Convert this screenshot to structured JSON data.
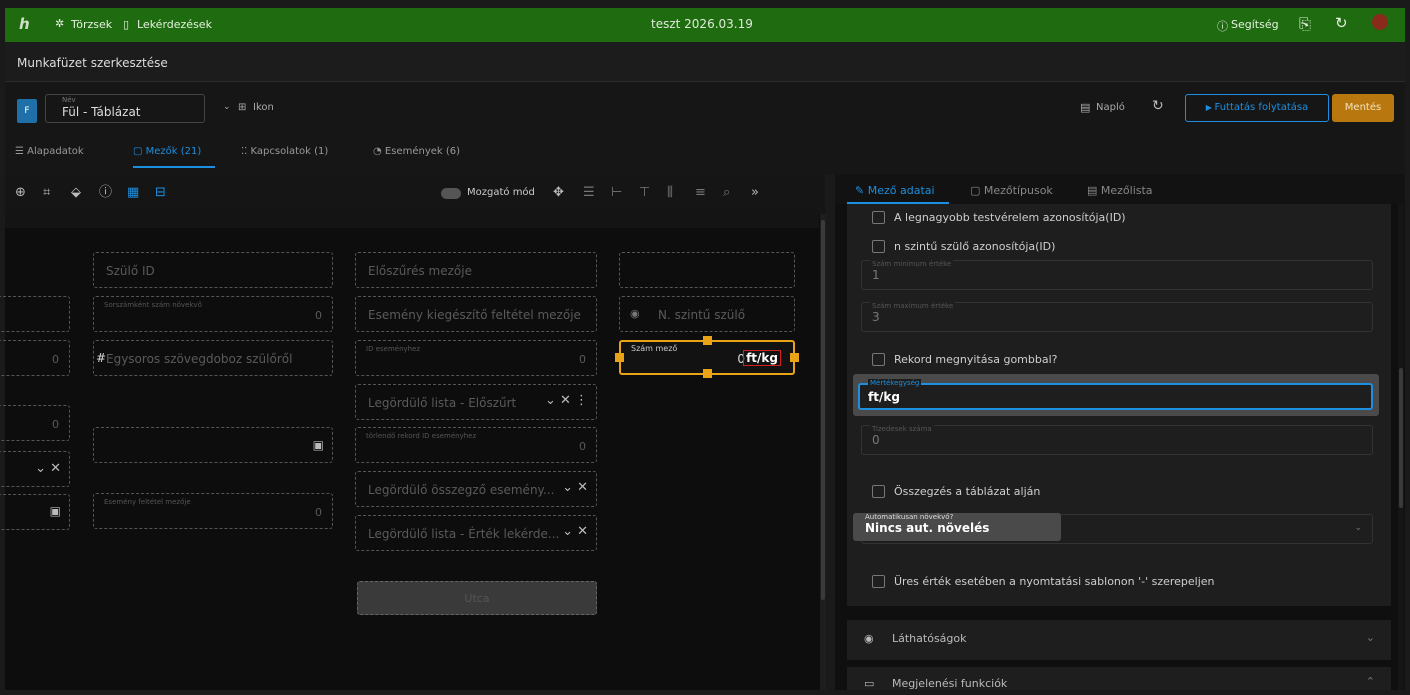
{
  "header": {
    "logo": "h",
    "nav_torzsek": "Törzsek",
    "nav_lekerdezesek": "Lekérdezések",
    "title": "teszt 2026.03.19",
    "help": "Segítség"
  },
  "subheader": {
    "title": "Munkafüzet szerkesztése"
  },
  "form": {
    "badge": "F",
    "name_label": "Név",
    "name_value": "Fül - Táblázat",
    "icon_label": "Ikon",
    "naplo": "Napló",
    "futtatas": "Futtatás folytatása",
    "mentes": "Mentés"
  },
  "tabs": [
    {
      "label": "Alapadatok"
    },
    {
      "label": "Mezők (21)"
    },
    {
      "label": "Kapcsolatok (1)"
    },
    {
      "label": "Események (6)"
    }
  ],
  "toolbar": {
    "mozgato": "Mozgató mód"
  },
  "canvas": {
    "szulo_id": "Szülő ID",
    "sorszam_label": "Sorszámként szám növekvő",
    "zero": "0",
    "egysoros": "Egysoros szövegdoboz szülőről",
    "hash": "#",
    "esemeny_feltetel": "Esemény feltétel mezője",
    "eloszures": "Előszűrés mezője",
    "esemeny_kieg": "Esemény kiegészítő feltétel mezője",
    "id_esemeny": "ID eseményhez",
    "legordulo_elo": "Legördülő lista - Előszűrt",
    "torlendo": "törlendő rekord ID eseményhez",
    "legordulo_osszegzo": "Legördülő összegző esemény...",
    "legordulo_ertek": "Legördülő lista - Érték lekérde...",
    "utca": "Utca",
    "n_szintu": "N. szintű szülő",
    "szam_mezo_label": "Szám mező",
    "szam_mezo_value": "0",
    "szam_mezo_unit": "ft/kg"
  },
  "rtabs": [
    {
      "label": "Mező adatai"
    },
    {
      "label": "Mezőtípusok"
    },
    {
      "label": "Mezőlista"
    }
  ],
  "props": {
    "cb1": "A legnagyobb testvérelem azonosítója(ID)",
    "cb2": "n szintű szülő azonosítója(ID)",
    "szam_min_label": "Szám minimum értéke",
    "szam_min_value": "1",
    "szam_max_label": "Szám maximum értéke",
    "szam_max_value": "3",
    "cb3": "Rekord megnyitása gombbal?",
    "mertekegyseg_label": "Mértékegység",
    "mertekegyseg_value": "ft/kg",
    "tizedesek_label": "Tizedesek száma",
    "tizedesek_value": "0",
    "cb4": "Összegzés a táblázat alján",
    "auto_label": "Automatikusan növekvő?",
    "auto_value": "Nincs aut. növelés",
    "cb5": "Üres érték esetében a nyomtatási sablonon '-' szerepeljen"
  },
  "accordions": {
    "lathatosagok": "Láthatóságok",
    "megjelenesi": "Megjelenési funkciók"
  },
  "colors": {
    "green": "#1f6b10",
    "orange": "#e8a317",
    "blue": "#1d8fe0",
    "mentes": "#b8780f"
  }
}
